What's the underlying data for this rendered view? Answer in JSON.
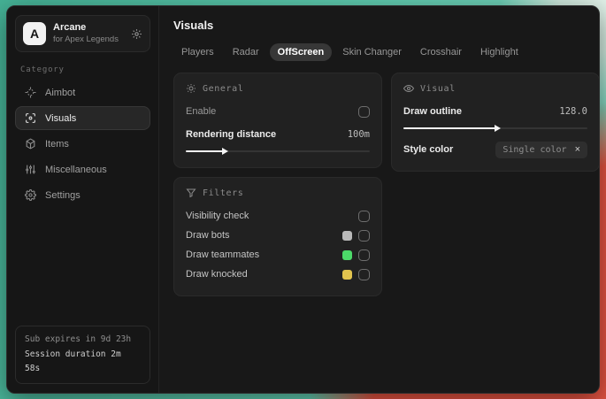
{
  "sidebar": {
    "brand": {
      "initial": "A",
      "name": "Arcane",
      "subtitle": "for Apex Legends"
    },
    "category_label": "Category",
    "items": [
      {
        "label": "Aimbot",
        "icon": "crosshair-icon",
        "active": false
      },
      {
        "label": "Visuals",
        "icon": "eye-scan-icon",
        "active": true
      },
      {
        "label": "Items",
        "icon": "package-icon",
        "active": false
      },
      {
        "label": "Miscellaneous",
        "icon": "sliders-icon",
        "active": false
      },
      {
        "label": "Settings",
        "icon": "gear-icon",
        "active": false
      }
    ],
    "footer": {
      "line1": "Sub expires in 9d 23h",
      "line2": "Session duration 2m 58s"
    }
  },
  "main": {
    "title": "Visuals",
    "tabs": [
      {
        "label": "Players",
        "active": false
      },
      {
        "label": "Radar",
        "active": false
      },
      {
        "label": "OffScreen",
        "active": true
      },
      {
        "label": "Skin Changer",
        "active": false
      },
      {
        "label": "Crosshair",
        "active": false
      },
      {
        "label": "Highlight",
        "active": false
      }
    ],
    "panels": {
      "general": {
        "title": "General",
        "icon": "sun-icon",
        "enable_label": "Enable",
        "enable_checked": false,
        "distance_label": "Rendering distance",
        "distance_value": "100m",
        "distance_percent": 20
      },
      "visual": {
        "title": "Visual",
        "icon": "eye-icon",
        "outline_label": "Draw outline",
        "outline_value": "128.0",
        "outline_percent": 50,
        "style_label": "Style color",
        "style_chip": "Single color",
        "chip_close": "×"
      },
      "filters": {
        "title": "Filters",
        "icon": "funnel-icon",
        "rows": [
          {
            "label": "Visibility check",
            "swatch": null,
            "checked": false
          },
          {
            "label": "Draw bots",
            "swatch": "#b9b9b9",
            "checked": false
          },
          {
            "label": "Draw teammates",
            "swatch": "#4cd969",
            "checked": false
          },
          {
            "label": "Draw knocked",
            "swatch": "#e2c44e",
            "checked": false
          }
        ]
      }
    }
  },
  "colors": {
    "backdrop_teal": "#52c2a4",
    "backdrop_red": "#e25240",
    "window_bg": "#181818",
    "panel_bg": "#212121",
    "accent_text": "#f2f2f2"
  }
}
